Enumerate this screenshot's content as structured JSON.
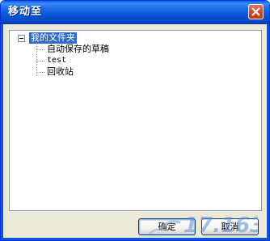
{
  "window": {
    "title": "移动至"
  },
  "tree": {
    "root": {
      "label": "我的文件夹",
      "expanded": true,
      "selected": true
    },
    "children": [
      {
        "label": "自动保存的草稿"
      },
      {
        "label": "test"
      },
      {
        "label": "回收站"
      }
    ]
  },
  "buttons": {
    "ok_label": "确定",
    "cancel_label": "取消"
  },
  "watermark": {
    "text": "17.163"
  },
  "colors": {
    "titlebar": "#0a55d8",
    "selection": "#316ac5",
    "dialog_bg": "#ece9d8"
  }
}
